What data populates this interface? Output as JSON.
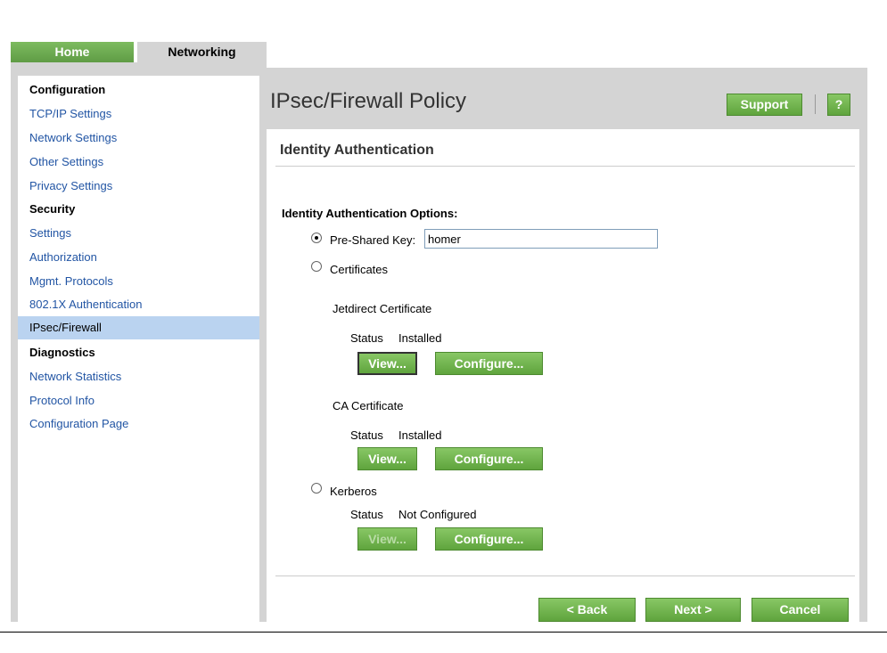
{
  "tabs": {
    "home": "Home",
    "networking": "Networking"
  },
  "sidebar": {
    "sections": [
      {
        "heading": "Configuration",
        "items": [
          "TCP/IP Settings",
          "Network Settings",
          "Other Settings",
          "Privacy Settings"
        ]
      },
      {
        "heading": "Security",
        "items": [
          "Settings",
          "Authorization",
          "Mgmt. Protocols",
          "802.1X Authentication",
          "IPsec/Firewall"
        ]
      },
      {
        "heading": "Diagnostics",
        "items": [
          "Network Statistics",
          "Protocol Info",
          "Configuration Page"
        ]
      }
    ],
    "selected": "IPsec/Firewall"
  },
  "header": {
    "title": "IPsec/Firewall Policy",
    "support_label": "Support",
    "help_label": "?"
  },
  "section_title": "Identity Authentication",
  "options": {
    "title": "Identity Authentication Options:",
    "psk": {
      "label": "Pre-Shared Key:",
      "value": "homer",
      "checked": true
    },
    "certificates": {
      "label": "Certificates",
      "checked": false
    },
    "jetdirect": {
      "label": "Jetdirect Certificate",
      "status_label": "Status",
      "status_value": "Installed",
      "view": "View...",
      "configure": "Configure..."
    },
    "ca": {
      "label": "CA Certificate",
      "status_label": "Status",
      "status_value": "Installed",
      "view": "View...",
      "configure": "Configure..."
    },
    "kerberos": {
      "label": "Kerberos",
      "checked": false,
      "status_label": "Status",
      "status_value": "Not Configured",
      "view": "View...",
      "configure": "Configure..."
    }
  },
  "footer": {
    "back": "< Back",
    "next": "Next >",
    "cancel": "Cancel"
  },
  "colors": {
    "accent_green": "#70b64c",
    "selected_bg": "#bad3f0",
    "link": "#2255a4",
    "frame_gray": "#d4d4d4"
  }
}
